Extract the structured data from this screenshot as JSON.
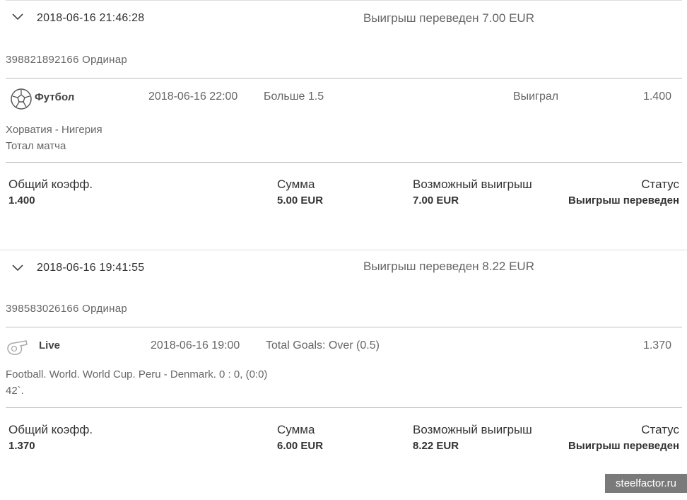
{
  "bets": [
    {
      "datetime": "2018-06-16 21:46:28",
      "result": "Выигрыш переведен 7.00 EUR",
      "bet_id": "398821892166 Ординар",
      "event": {
        "sport_icon": "soccer-ball-icon",
        "sport": "Футбол",
        "date": "2018-06-16 22:00",
        "pick": "Больше 1.5",
        "status": "Выиграл",
        "odd": "1.400",
        "match": "Хорватия - Нигерия",
        "market": "Тотал матча"
      },
      "summary": {
        "coef_label": "Общий коэфф.",
        "coef": "1.400",
        "stake_label": "Сумма",
        "stake": "5.00 EUR",
        "payout_label": "Возможный выигрыш",
        "payout": "7.00 EUR",
        "status_label": "Статус",
        "status": "Выигрыш переведен"
      }
    },
    {
      "datetime": "2018-06-16 19:41:55",
      "result": "Выигрыш переведен 8.22 EUR",
      "bet_id": "398583026166 Ординар",
      "event": {
        "sport_icon": "whistle-icon",
        "sport": "Live",
        "date": "2018-06-16 19:00",
        "pick": "Total Goals: Over (0.5)",
        "status": "",
        "odd": "1.370",
        "match": "Football. World. World Cup. Peru - Denmark. 0 : 0, (0:0) 42`.",
        "market": ""
      },
      "summary": {
        "coef_label": "Общий коэфф.",
        "coef": "1.370",
        "stake_label": "Сумма",
        "stake": "6.00 EUR",
        "payout_label": "Возможный выигрыш",
        "payout": "8.22 EUR",
        "status_label": "Статус",
        "status": "Выигрыш переведен"
      }
    }
  ],
  "watermark": "steelfactor.ru"
}
